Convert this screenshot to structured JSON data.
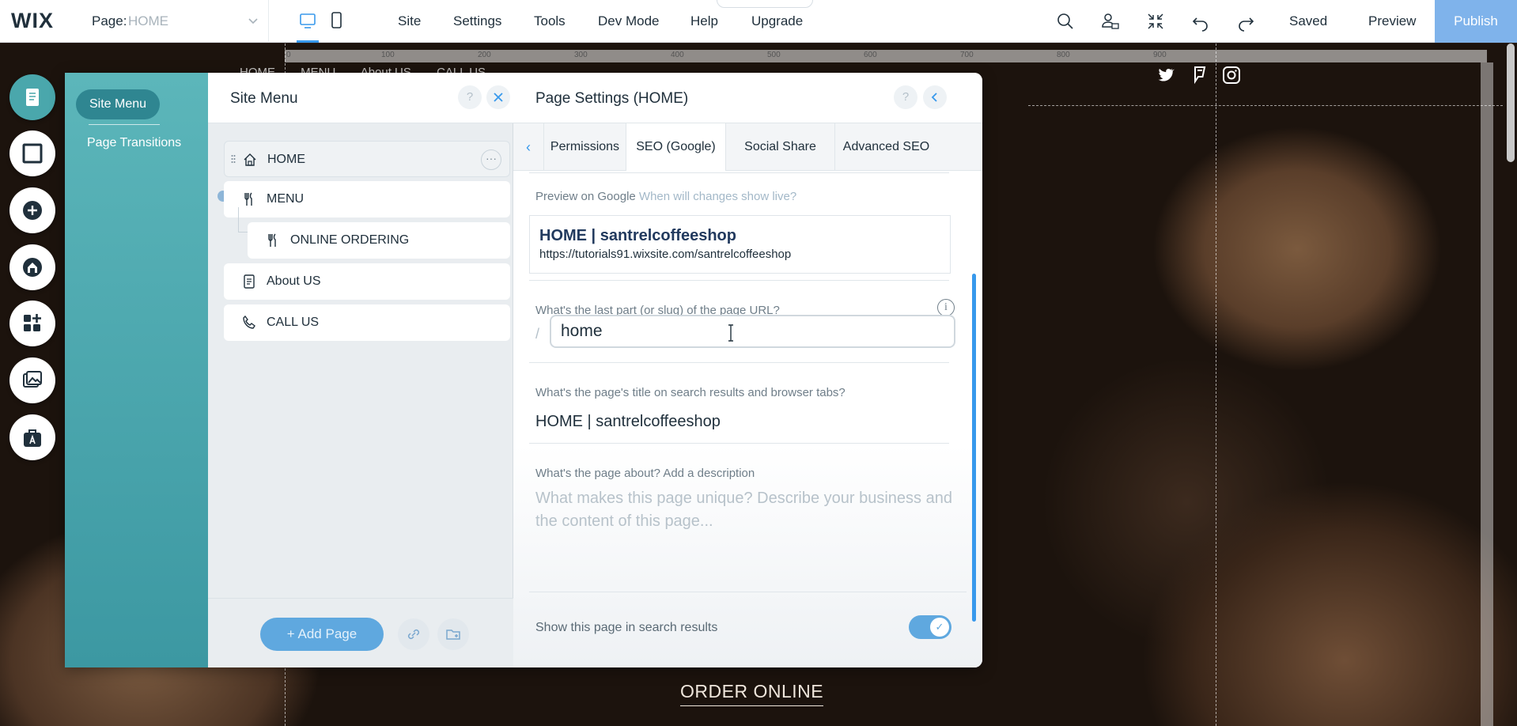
{
  "topbar": {
    "logo": "WIX",
    "page_label": "Page:",
    "page_value": "HOME",
    "menu": [
      "Site",
      "Settings",
      "Tools",
      "Dev Mode",
      "Help",
      "Upgrade"
    ],
    "saved": "Saved",
    "preview": "Preview",
    "publish": "Publish"
  },
  "canvas": {
    "nav": [
      "HOME",
      "MENU",
      "About US",
      "CALL US"
    ],
    "ruler": [
      "0",
      "100",
      "200",
      "300",
      "400",
      "500",
      "600",
      "700",
      "800",
      "900"
    ],
    "order_online": "ORDER ONLINE"
  },
  "rail": [
    "pages-icon",
    "strip-icon",
    "add-icon",
    "home-icon",
    "apps-icon",
    "media-icon",
    "business-icon"
  ],
  "panel": {
    "left_nav": {
      "active": "Site Menu",
      "item": "Page Transitions"
    },
    "site_menu": {
      "title": "Site Menu",
      "help": "?",
      "pages": [
        {
          "label": "HOME",
          "icon": "home-icon"
        },
        {
          "label": "MENU",
          "icon": "fork-knife-icon"
        },
        {
          "label": "ONLINE ORDERING",
          "icon": "fork-knife-icon"
        },
        {
          "label": "About US",
          "icon": "page-icon"
        },
        {
          "label": "CALL US",
          "icon": "phone-icon"
        }
      ],
      "add_page": "+ Add Page"
    },
    "page_settings": {
      "title": "Page Settings (HOME)",
      "help": "?",
      "tabs": [
        "Permissions",
        "SEO (Google)",
        "Social Share",
        "Advanced SEO"
      ],
      "preview_label": "Preview on Google",
      "preview_link": "When will changes show live?",
      "preview_title": "HOME | santrelcoffeeshop",
      "preview_url": "https://tutorials91.wixsite.com/santrelcoffeeshop",
      "slug_label": "What's the last part (or slug) of the page URL?",
      "slug_prefix": "/",
      "slug_value": "home",
      "title_label": "What's the page's title on search results and browser tabs?",
      "title_value": "HOME | santrelcoffeeshop",
      "desc_label": "What's the page about? Add a description",
      "desc_placeholder": "What makes this page unique? Describe your business and the content of this page...",
      "toggle_label": "Show this page in search results",
      "toggle_on": true
    }
  },
  "colors": {
    "accent": "#3899ec",
    "teal": "#4aa7ac",
    "publish": "#7fb3eb"
  }
}
